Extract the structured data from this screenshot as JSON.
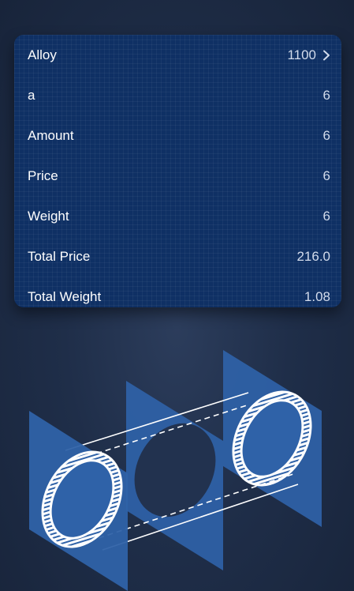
{
  "rows": [
    {
      "label": "Alloy",
      "value": "1100",
      "interactable": true,
      "chevron": true
    },
    {
      "label": "a",
      "value": "6"
    },
    {
      "label": "Amount",
      "value": "6"
    },
    {
      "label": "Price",
      "value": "6"
    },
    {
      "label": "Weight",
      "value": "6"
    },
    {
      "label": "Total Price",
      "value": "216.0"
    },
    {
      "label": "Total Weight",
      "value": "1.08"
    }
  ],
  "icons": {
    "alloy_chevron": "chevron-right-icon",
    "illustration": "tube-cross-section-illustration"
  },
  "colors": {
    "card_background": "#0f3064",
    "page_background": "#1f2e49",
    "plane_blue": "#2f62a8",
    "text_primary": "#ffffff",
    "text_value": "#d3dcec"
  }
}
